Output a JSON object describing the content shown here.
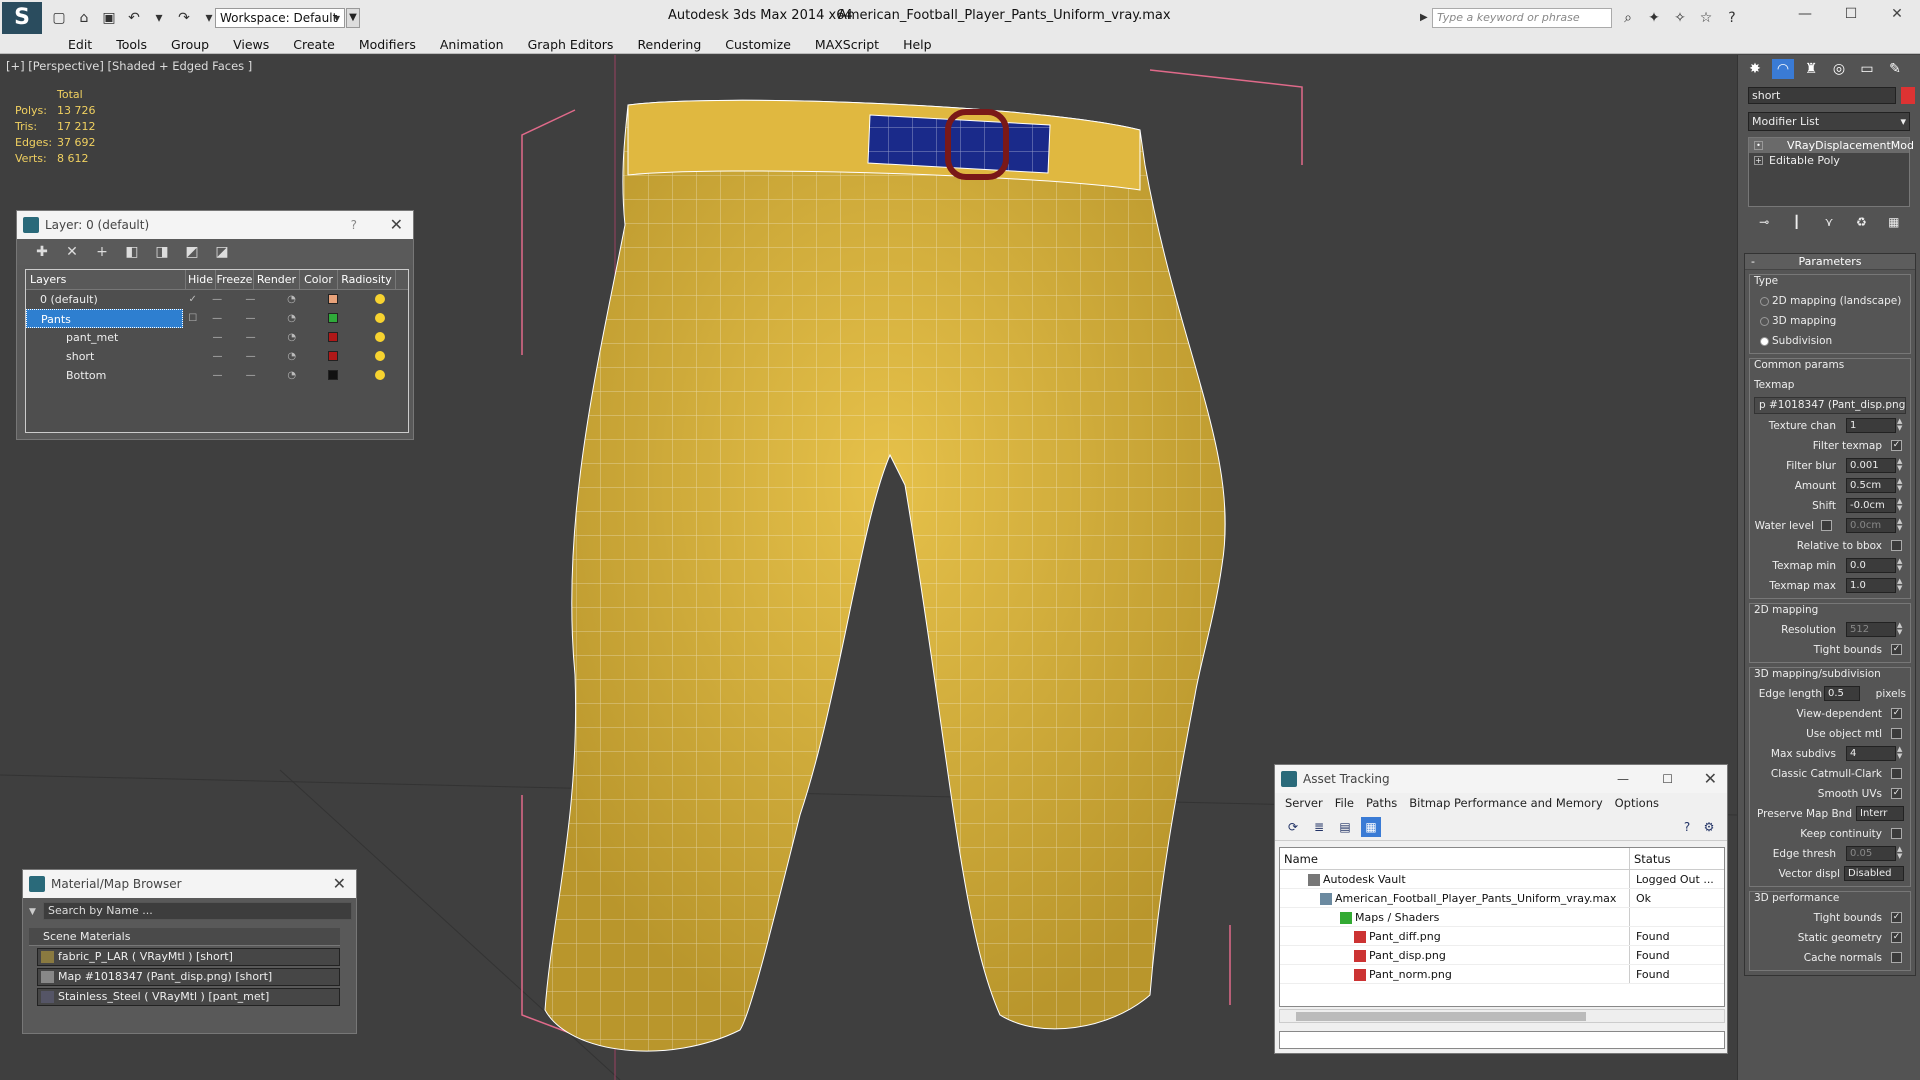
{
  "app": {
    "title": "Autodesk 3ds Max  2014 x64",
    "file": "American_Football_Player_Pants_Uniform_vray.max",
    "workspace": "Workspace: Default",
    "search_placeholder": "Type a keyword or phrase"
  },
  "menu": [
    "Edit",
    "Tools",
    "Group",
    "Views",
    "Create",
    "Modifiers",
    "Animation",
    "Graph Editors",
    "Rendering",
    "Customize",
    "MAXScript",
    "Help"
  ],
  "viewport": {
    "label": "[+] [Perspective] [Shaded + Edged Faces ]",
    "stats": {
      "header": "Total",
      "rows": [
        {
          "label": "Polys:",
          "value": "13 726"
        },
        {
          "label": "Tris:",
          "value": "17 212"
        },
        {
          "label": "Edges:",
          "value": "37 692"
        },
        {
          "label": "Verts:",
          "value": "8 612"
        }
      ]
    }
  },
  "layer_manager": {
    "title": "Layer: 0 (default)",
    "help": "?",
    "columns": [
      "Layers",
      "Hide",
      "Freeze",
      "Render",
      "Color",
      "Radiosity"
    ],
    "rows": [
      {
        "name": "0 (default)",
        "color": "#e8a27a",
        "selected": false,
        "check": "✓"
      },
      {
        "name": "Pants",
        "color": "#2faa3a",
        "selected": true,
        "check": ""
      },
      {
        "name": "pant_met",
        "color": "#b01818",
        "selected": false,
        "check": ""
      },
      {
        "name": "short",
        "color": "#b01818",
        "selected": false,
        "check": ""
      },
      {
        "name": "Bottom",
        "color": "#111111",
        "selected": false,
        "check": ""
      }
    ]
  },
  "material_browser": {
    "title": "Material/Map Browser",
    "search_placeholder": "Search by Name ...",
    "section": "Scene Materials",
    "items": [
      "fabric_P_LAR  ( VRayMtl ) [short]",
      "Map #1018347 (Pant_disp.png) [short]",
      "Stainless_Steel  ( VRayMtl ) [pant_met]"
    ]
  },
  "asset_tracking": {
    "title": "Asset Tracking",
    "menu": [
      "Server",
      "File",
      "Paths",
      "Bitmap Performance and Memory",
      "Options"
    ],
    "columns": [
      "Name",
      "Status"
    ],
    "rows": [
      {
        "name": "Autodesk Vault",
        "status": "Logged Out ...",
        "indent": 1
      },
      {
        "name": "American_Football_Player_Pants_Uniform_vray.max",
        "status": "Ok",
        "indent": 2
      },
      {
        "name": "Maps / Shaders",
        "status": "",
        "indent": 3
      },
      {
        "name": "Pant_diff.png",
        "status": "Found",
        "indent": 4
      },
      {
        "name": "Pant_disp.png",
        "status": "Found",
        "indent": 4
      },
      {
        "name": "Pant_norm.png",
        "status": "Found",
        "indent": 4
      }
    ]
  },
  "command_panel": {
    "object_name": "short",
    "object_color": "#dd3333",
    "modifier_list": "Modifier List",
    "stack": [
      "VRayDisplacementMod",
      "Editable Poly"
    ],
    "parameters_title": "Parameters",
    "type_group": "Type",
    "type_options": [
      "2D mapping (landscape)",
      "3D mapping",
      "Subdivision"
    ],
    "common_params": "Common params",
    "texmap_label": "Texmap",
    "texmap_value": "p #1018347 (Pant_disp.png)",
    "texture_chan_label": "Texture chan",
    "texture_chan_value": "1",
    "filter_texmap": "Filter texmap",
    "filter_blur_label": "Filter blur",
    "filter_blur_value": "0.001",
    "amount_label": "Amount",
    "amount_value": "0.5cm",
    "shift_label": "Shift",
    "shift_value": "-0.0cm",
    "water_level_label": "Water level",
    "water_level_value": "0.0cm",
    "relative_bbox": "Relative to bbox",
    "texmap_min_label": "Texmap min",
    "texmap_min_value": "0.0",
    "texmap_max_label": "Texmap max",
    "texmap_max_value": "1.0",
    "mapping2d_group": "2D mapping",
    "resolution_label": "Resolution",
    "resolution_value": "512",
    "tight_bounds": "Tight bounds",
    "mapping3d_group": "3D mapping/subdivision",
    "edge_length_label": "Edge length",
    "edge_length_value": "0.5",
    "pixels": "pixels",
    "view_dependent": "View-dependent",
    "use_object_mtl": "Use object mtl",
    "max_subdivs_label": "Max subdivs",
    "max_subdivs_value": "4",
    "classic_cc": "Classic Catmull-Clark",
    "smooth_uvs": "Smooth UVs",
    "preserve_map_label": "Preserve Map Bnd",
    "preserve_map_value": "Interr",
    "keep_continuity": "Keep continuity",
    "edge_thresh_label": "Edge thresh",
    "edge_thresh_value": "0.05",
    "vector_displ_label": "Vector displ",
    "vector_displ_value": "Disabled",
    "perf_group": "3D performance",
    "tight_bounds2": "Tight bounds",
    "static_geometry": "Static geometry",
    "cache_normals": "Cache normals"
  }
}
